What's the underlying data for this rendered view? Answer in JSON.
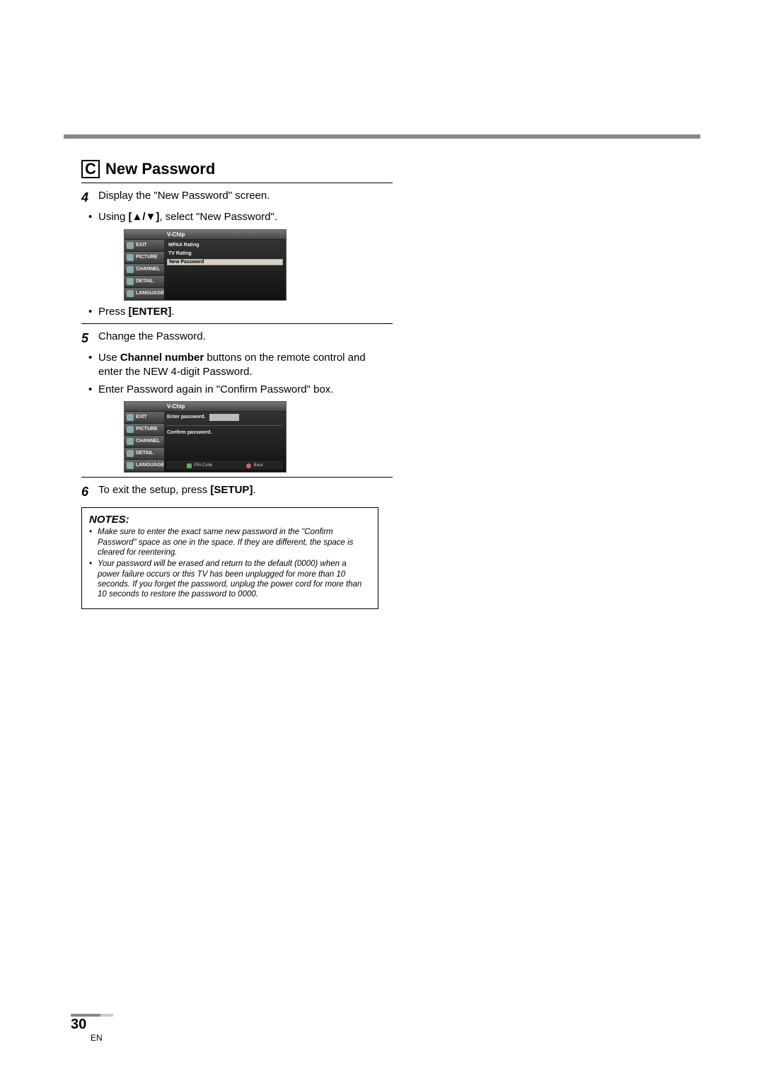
{
  "section": {
    "letter": "C",
    "title": "New Password"
  },
  "steps": {
    "s4": {
      "num": "4",
      "text": "Display the \"New Password\" screen.",
      "b1_pre": "Using ",
      "b1_keys": "[▲/▼]",
      "b1_post": ", select \"New Password\".",
      "b2_pre": "Press ",
      "b2_key": "[ENTER]",
      "b2_post": "."
    },
    "s5": {
      "num": "5",
      "text": "Change the Password.",
      "b1_pre": "Use ",
      "b1_bold": "Channel number",
      "b1_post": " buttons on the remote control and enter the NEW 4-digit Password.",
      "b2": "Enter Password again in \"Confirm Password\" box."
    },
    "s6": {
      "num": "6",
      "pre": "To exit the setup, press ",
      "key": "[SETUP]",
      "post": "."
    }
  },
  "tv": {
    "header": "V-Chip",
    "tabs": {
      "exit": "EXIT",
      "picture": "PICTURE",
      "channel": "CHANNEL",
      "detail": "DETAIL",
      "language": "LANGUAGE"
    },
    "menu1": {
      "item1": "MPAA Rating",
      "item2": "TV Rating",
      "item3": "New Password"
    },
    "menu2": {
      "enter": "Enter password.",
      "confirm": "Confirm password.",
      "pin": "PIN Code",
      "back": "Back"
    }
  },
  "notes": {
    "title": "NOTES:",
    "n1": "Make sure to enter the exact same new password in the \"Confirm Password\" space as one in the space. If they are different, the space is cleared for reentering.",
    "n2": "Your password will be erased and return to the default (0000) when a power failure occurs or this TV has been unplugged for more than 10 seconds. If you forget the password, unplug the power cord for more than 10 seconds to restore the password to 0000."
  },
  "footer": {
    "page": "30",
    "lang": "EN"
  }
}
